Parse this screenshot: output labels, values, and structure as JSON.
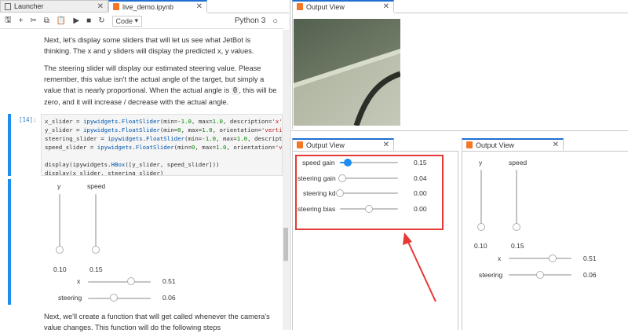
{
  "tabs": {
    "launcher": "Launcher",
    "notebook": "live_demo.ipynb",
    "output1": "Output View",
    "output2": "Output View",
    "output3": "Output View",
    "close": "✕"
  },
  "toolbar": {
    "cell_type": "Code",
    "kernel": "Python 3"
  },
  "notebook": {
    "para1": "Next, let's display some sliders that will let us see what JetBot is thinking. The x and y sliders will display the predicted x, y values.",
    "para2a": "The steering slider will display our estimated steering value. Please remember, this value isn't the actual angle of the target, but simply a value that is nearly proportional. When the actual angle is ",
    "para2_code": "0",
    "para2b": ", this will be zero, and it will increase / decrease with the actual angle.",
    "prompt": "[14]:",
    "para3": "Next, we'll create a function that will get called whenever the camera's value changes. This function will do the following steps"
  },
  "nb_widgets": {
    "y_label": "y",
    "speed_label": "speed",
    "y_value": "0.10",
    "speed_value": "0.15",
    "x_label": "x",
    "x_value": "0.51",
    "steering_label": "steering",
    "steering_value": "0.06"
  },
  "gains": {
    "speed_gain": "speed gain",
    "speed_gain_value": "0.15",
    "steering_gain": "steering gain",
    "steering_gain_value": "0.04",
    "steering_kd": "steering kd",
    "steering_kd_value": "0.00",
    "steering_bias": "steering bias",
    "steering_bias_value": "0.00"
  },
  "out3": {
    "y_label": "y",
    "speed_label": "speed",
    "y_value": "0.10",
    "speed_value": "0.15",
    "x_label": "x",
    "x_value": "0.51",
    "steering_label": "steering",
    "steering_value": "0.06"
  },
  "colors": {
    "accent": "#1f8cf0",
    "annotation": "#e53935",
    "notebook_icon": "#f37726"
  }
}
